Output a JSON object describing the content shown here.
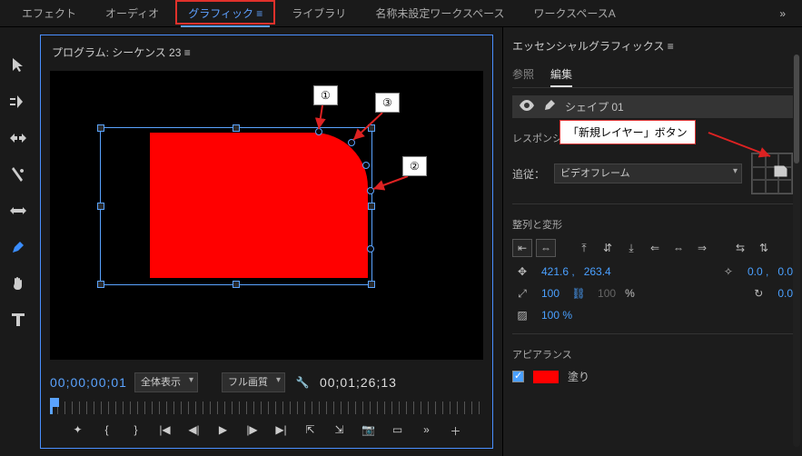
{
  "tabs": {
    "t0": "エフェクト",
    "t1": "オーディオ",
    "t2": "グラフィック",
    "t3": "ライブラリ",
    "t4": "名称未設定ワークスペース",
    "t5": "ワークスペースA",
    "overflow": "»"
  },
  "program": {
    "title": "プログラム: シーケンス 23 ≡",
    "timecode_in": "00;00;00;01",
    "timecode_out": "00;01;26;13",
    "zoom_options": [
      "全体表示"
    ],
    "zoom_value": "全体表示",
    "quality_value": "フル画質"
  },
  "callouts": {
    "c1": "①",
    "c2": "②",
    "c3": "③",
    "new_layer": "「新規レイヤー」ボタン"
  },
  "egp": {
    "title": "エッセンシャルグラフィックス ≡",
    "tab_browse": "参照",
    "tab_edit": "編集",
    "layer_name": "シェイプ 01",
    "responsive_title": "レスポンシブデザイン - 位置",
    "follow_label": "追従：",
    "follow_value": "ビデオフレーム",
    "align_title": "整列と変形",
    "pos_x": "421.6 ,",
    "pos_y": "263.4",
    "anchor_x": "0.0 ,",
    "anchor_y": "0.0",
    "scale_w": "100",
    "scale_h": "100",
    "scale_pct": "%",
    "rotation": "0.0",
    "opacity": "100 %",
    "appearance_title": "アピアランス",
    "fill_label": "塗り",
    "fill_color": "#ff0000"
  }
}
